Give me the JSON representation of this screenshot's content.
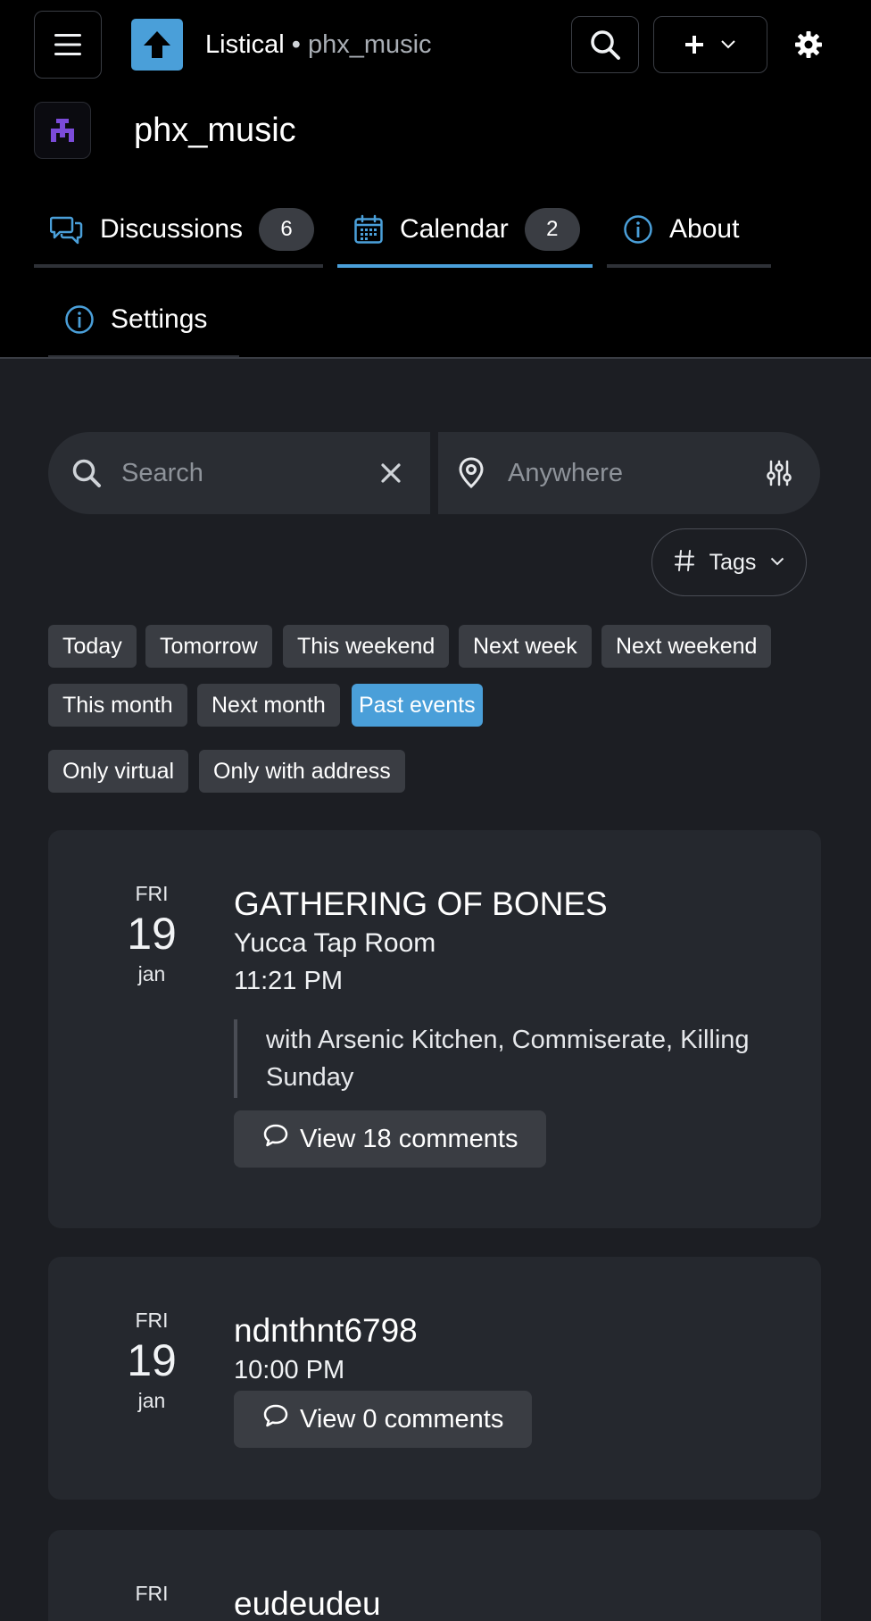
{
  "header": {
    "app_name": "Listical",
    "separator": " • ",
    "community_slug": "phx_music",
    "accent_color": "#4a9fd9",
    "icons": [
      "hamburger-menu-icon",
      "upvote-arrow-icon",
      "search-icon",
      "plus-icon",
      "chevron-down-icon",
      "gear-icon"
    ]
  },
  "community": {
    "name": "phx_music",
    "avatar_icon": "community-logo-icon"
  },
  "tabs": [
    {
      "label": "Discussions",
      "count": "6",
      "icon": "chat-bubbles-icon"
    },
    {
      "label": "Calendar",
      "count": "2",
      "icon": "calendar-icon",
      "active": true
    },
    {
      "label": "About",
      "icon": "info-icon"
    },
    {
      "label": "Settings",
      "icon": "info-icon"
    }
  ],
  "search": {
    "placeholder": "Search",
    "value": "",
    "location_placeholder": "Anywhere",
    "location_value": ""
  },
  "tags_button": {
    "label": "Tags",
    "icon": "hash-icon"
  },
  "filters": {
    "date_chips": [
      "Today",
      "Tomorrow",
      "This weekend",
      "Next week",
      "Next weekend",
      "This month",
      "Next month",
      "Past events"
    ],
    "active_chip": "Past events",
    "location_chips": [
      "Only virtual",
      "Only with address"
    ]
  },
  "events": [
    {
      "dow": "FRI",
      "day": "19",
      "month": "jan",
      "title": "GATHERING OF BONES",
      "venue": "Yucca Tap Room",
      "time": "11:21 PM",
      "description": "with Arsenic Kitchen, Commiserate, Killing Sunday",
      "comments_label": "View 18 comments"
    },
    {
      "dow": "FRI",
      "day": "19",
      "month": "jan",
      "title": "ndnthnt6798",
      "time": "10:00 PM",
      "comments_label": "View 0 comments"
    },
    {
      "dow": "FRI",
      "title": "eudeudeu"
    }
  ]
}
